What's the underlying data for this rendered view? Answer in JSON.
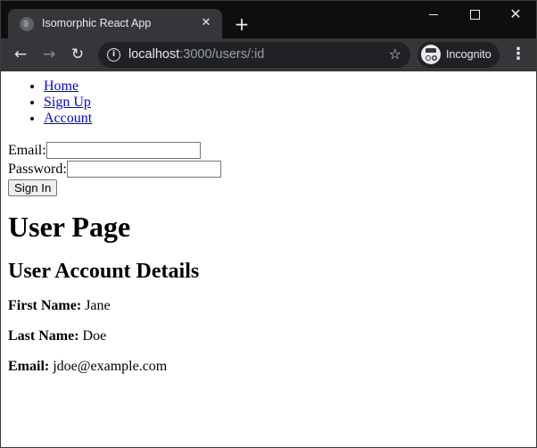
{
  "browser": {
    "tab_title": "Isomorphic React App",
    "url_host": "localhost",
    "url_path": ":3000/users/:id",
    "incognito_label": "Incognito",
    "icons": {
      "favicon": "globe-icon",
      "tab_close": "close-icon",
      "new_tab": "plus-icon",
      "back": "arrow-left-icon",
      "forward": "arrow-right-icon",
      "reload": "reload-icon",
      "info": "info-icon",
      "bookmark": "star-icon",
      "menu": "kebab-menu-icon"
    }
  },
  "nav": {
    "items": [
      {
        "label": "Home"
      },
      {
        "label": "Sign Up"
      },
      {
        "label": "Account"
      }
    ]
  },
  "login": {
    "email_label": "Email:",
    "email_value": "",
    "password_label": "Password:",
    "password_value": "",
    "submit_label": "Sign In"
  },
  "page": {
    "title": "User Page",
    "subtitle": "User Account Details"
  },
  "details": {
    "first_name_label": "First Name:",
    "first_name": "Jane",
    "last_name_label": "Last Name:",
    "last_name": "Doe",
    "email_label": "Email:",
    "email": "jdoe@example.com"
  }
}
